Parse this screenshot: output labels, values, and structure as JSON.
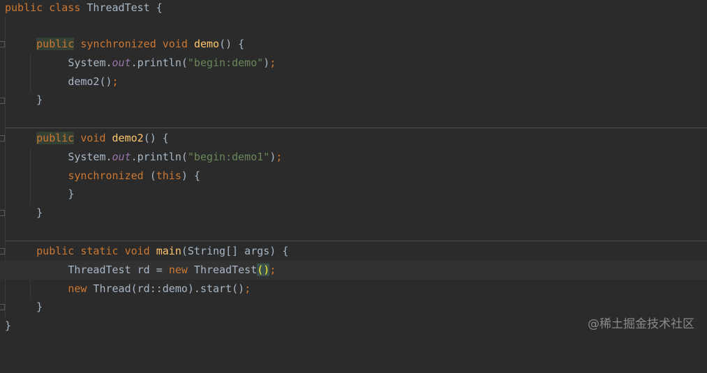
{
  "code": {
    "class_kw1": "public",
    "class_kw2": "class",
    "class_name": "ThreadTest",
    "open_brace": "{",
    "close_brace": "}",
    "m1": {
      "mod": "public",
      "sync": "synchronized",
      "ret": "void",
      "name": "demo",
      "params": "()",
      "open": "{",
      "close": "}",
      "l1_obj": "System.",
      "l1_field": "out",
      "l1_call": ".println(",
      "l1_str": "\"begin:demo\"",
      "l1_end": ")",
      "l1_semi": ";",
      "l2_call": "demo2()",
      "l2_semi": ";"
    },
    "m2": {
      "mod": "public",
      "ret": "void",
      "name": "demo2",
      "params": "()",
      "open": "{",
      "close": "}",
      "l1_obj": "System.",
      "l1_field": "out",
      "l1_call": ".println(",
      "l1_str": "\"begin:demo1\"",
      "l1_end": ")",
      "l1_semi": ";",
      "sync_kw": "synchronized",
      "sync_open": "(",
      "sync_this": "this",
      "sync_close": ")",
      "sync_brace": "{",
      "sync_end": "}"
    },
    "m3": {
      "mod": "public",
      "stat": "static",
      "ret": "void",
      "name": "main",
      "params": "(String[] args)",
      "open": "{",
      "close": "}",
      "l1_type": "ThreadTest rd = ",
      "l1_new": "new",
      "l1_ctor": " ThreadTest",
      "l1_paren": "()",
      "l1_semi": ";",
      "l2_new": "new",
      "l2_call": " Thread(rd::demo).start()",
      "l2_semi": ";"
    }
  },
  "watermark": "@稀土掘金技术社区"
}
